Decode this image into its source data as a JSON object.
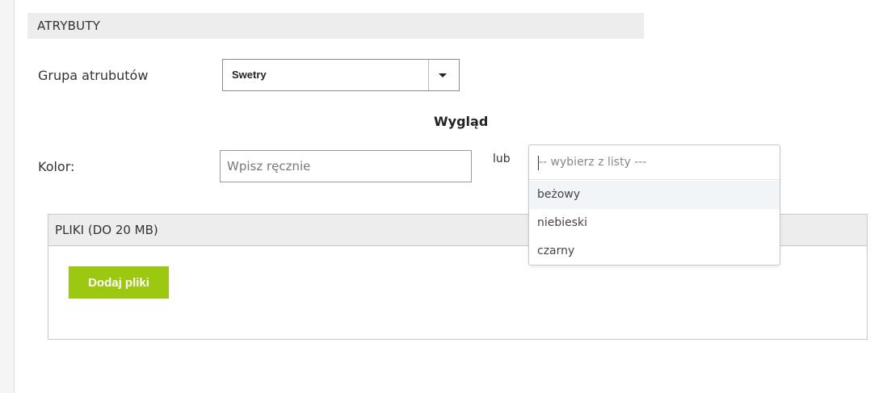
{
  "attributes_section": {
    "title": "ATRYBUTY",
    "group_label": "Grupa atrubutów",
    "group_selected": "Swetry",
    "appearance_heading": "Wygląd",
    "color_label": "Kolor:",
    "color_input_placeholder": "Wpisz ręcznie",
    "or_label": "lub",
    "color_dropdown": {
      "search_placeholder": "-- wybierz z listy ---",
      "options": [
        "beżowy",
        "niebieski",
        "czarny"
      ],
      "highlighted_option": "beżowy"
    }
  },
  "files_section": {
    "title": "PLIKI (DO 20 MB)",
    "add_button_label": "Dodaj pliki",
    "add_button_color": "#9cc812"
  }
}
